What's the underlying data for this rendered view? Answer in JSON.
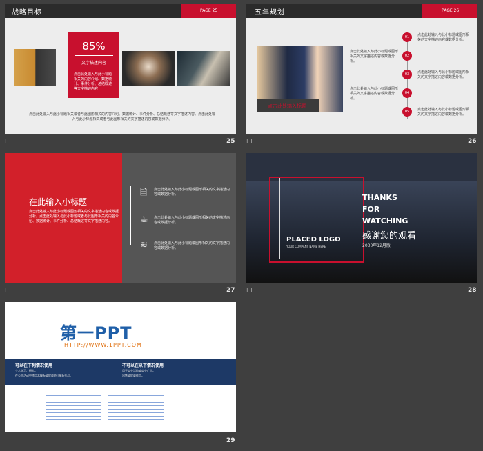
{
  "slides": [
    {
      "number": "25",
      "title": "战略目标",
      "page_label": "PAGE 25",
      "percent": "85%",
      "box_title": "文字描述内容",
      "box_text": "点击此处输入与此小标题相关的内容介绍、数据统计、事件分析、总结概述等文字描述内容",
      "body_text": "点击此处输入与此小标题相关或者与此图形相关的内容介绍、数据统计、事件分析、总结概述等文字描述内容。点击此处输入与此小标题相关或者与此图形相关的文字描述内容或数据分析。"
    },
    {
      "number": "26",
      "title": "五年规划",
      "page_label": "PAGE 26",
      "photo_caption": "点击此处输入标题",
      "steps": [
        "01",
        "02",
        "03",
        "04",
        "05"
      ],
      "left_text": "点击此处输入与此小标题或图形相关的文字描述内容或数据分析。",
      "right_text": "点击此处输入与此小标题或图形相关的文字描述内容或数据分析。"
    },
    {
      "number": "27",
      "heading": "在此输入小标题",
      "body": "点击此处输入与此小标题或图形相关的文字描述内容或数据分析。点击此处输入与此小标题或者与此图形相关的内容介绍、数据统计、事件分析、总结概述等文字描述内容。",
      "items": [
        "点击此处输入与此小标题或图形相关的文字描述内容或数据分析。",
        "点击此处输入与此小标题或图形相关的文字描述内容或数据分析。",
        "点击此处输入与此小标题或图形相关的文字描述内容或数据分析。"
      ]
    },
    {
      "number": "28",
      "logo": "PLACED LOGO",
      "logo_sub": "YOUR COMPANY NAME HERE",
      "thanks": "THANKS",
      "for": "FOR",
      "watching": "WATCHING",
      "cn_thanks": "感谢您的观看",
      "date": "2030年12月版"
    },
    {
      "number": "29",
      "brand": "第一PPT",
      "url": "HTTP://WWW.1PPT.COM",
      "can_title": "可以在下列情况使用",
      "can_items": [
        "个人学习、研究。",
        "在公益活动中使用本模板或转载PPT模板作品。"
      ],
      "cannot_title": "不可以在以下情况使用",
      "cannot_items": [
        "用于商业活动或商业广告。",
        "出售或转载作品。"
      ]
    }
  ],
  "slide_icon": "□"
}
